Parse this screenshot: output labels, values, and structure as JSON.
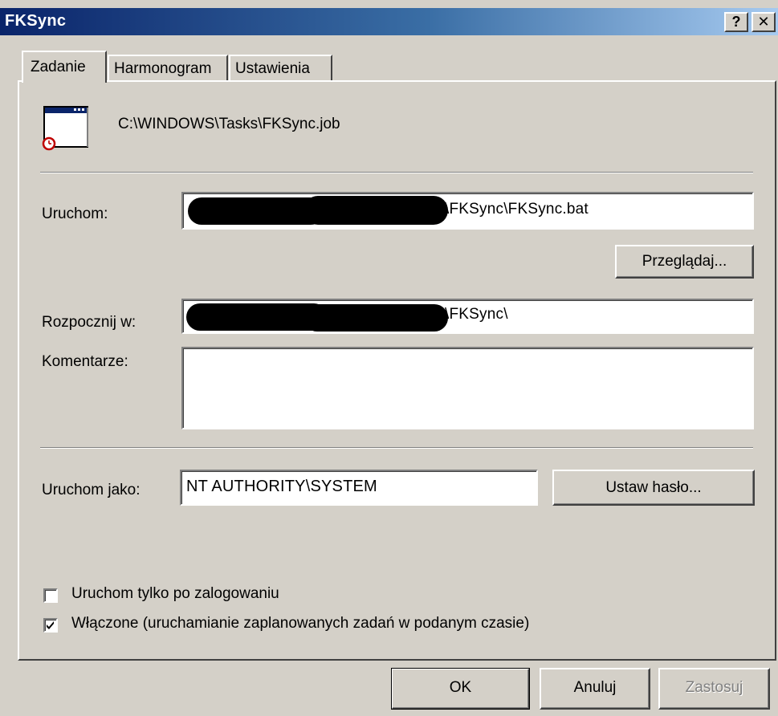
{
  "window": {
    "title": "FKSync",
    "help_glyph": "?",
    "close_glyph": "✕"
  },
  "tabs": [
    {
      "label": "Zadanie",
      "active": true
    },
    {
      "label": "Harmonogram",
      "active": false
    },
    {
      "label": "Ustawienia",
      "active": false
    }
  ],
  "task": {
    "icon": "scheduled-task-icon",
    "path": "C:\\WINDOWS\\Tasks\\FKSync.job"
  },
  "form": {
    "run_label": "Uruchom:",
    "run_value_visible": "\\FKSync\\FKSync.bat",
    "browse_label": "Przeglądaj...",
    "start_in_label": "Rozpocznij w:",
    "start_in_value_visible": "\\FKSync\\",
    "comments_label": "Komentarze:",
    "comments_value": "",
    "run_as_label": "Uruchom jako:",
    "run_as_value": "NT AUTHORITY\\SYSTEM",
    "set_password_label": "Ustaw hasło..."
  },
  "options": {
    "run_only_logged_on": {
      "label": "Uruchom tylko po zalogowaniu",
      "checked": false
    },
    "enabled": {
      "label": "Włączone (uruchamianie zaplanowanych zadań w podanym czasie)",
      "checked": true
    }
  },
  "footer": {
    "ok_label": "OK",
    "cancel_label": "Anuluj",
    "apply_label": "Zastosuj",
    "apply_enabled": false
  },
  "colors": {
    "dialog_bg": "#d4d0c8",
    "titlebar_start": "#0a246a",
    "titlebar_end": "#a6caf0",
    "disabled_text": "#808080"
  }
}
